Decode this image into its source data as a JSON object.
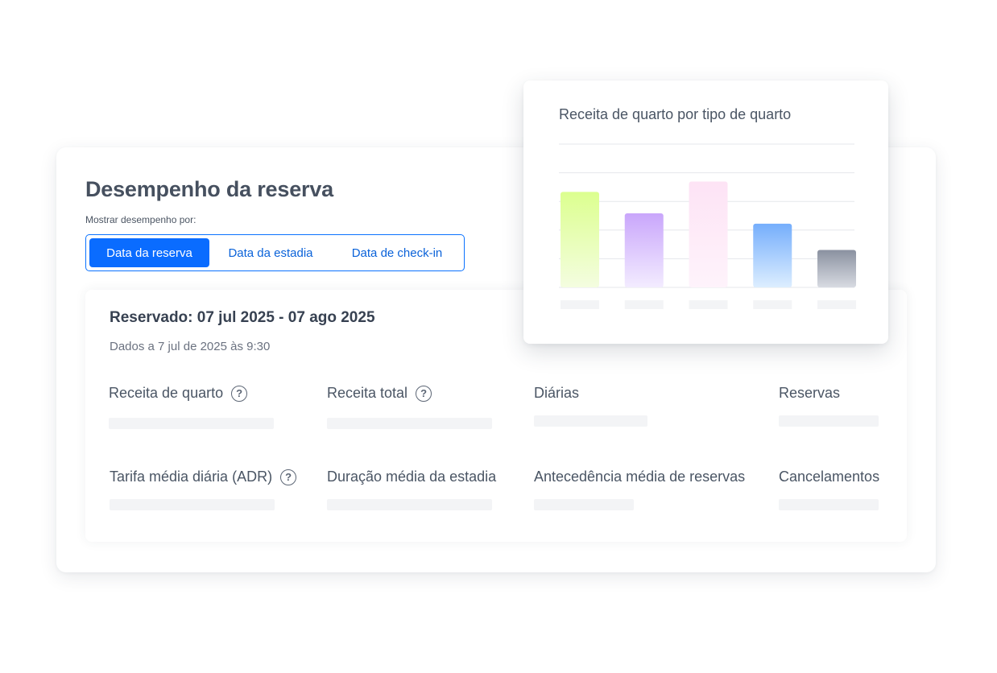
{
  "header": {
    "title": "Desempenho da reserva",
    "show_by_label": "Mostrar desempenho por:"
  },
  "tabs": [
    {
      "label": "Data da reserva",
      "active": true
    },
    {
      "label": "Data da estadia",
      "active": false
    },
    {
      "label": "Data de check-in",
      "active": false
    }
  ],
  "summary": {
    "period": "Reservado: 07 jul 2025 - 07 ago 2025",
    "data_as_of": "Dados a 7 jul de 2025 às 9:30"
  },
  "metrics": [
    {
      "label": "Receita de quarto",
      "help_icon": "question-circle-icon"
    },
    {
      "label": "Receita total",
      "help_icon": "question-circle-icon"
    },
    {
      "label": "Diárias"
    },
    {
      "label": "Reservas"
    },
    {
      "label": "Tarifa média diária (ADR)",
      "help_icon": "question-circle-icon"
    },
    {
      "label": "Duração média da estadia"
    },
    {
      "label": "Antecedência média de reservas"
    },
    {
      "label": "Cancelamentos"
    }
  ],
  "help_glyph": "?",
  "colors": {
    "accent": "#0a6cff",
    "bar_gradients": [
      [
        "#dcff8f",
        "#f4fde0"
      ],
      [
        "#c9a6fb",
        "#f3ecff"
      ],
      [
        "#fde3f5",
        "#fef3fb"
      ],
      [
        "#75aefc",
        "#ddeeff"
      ],
      [
        "#8a91a0",
        "#d8dbe2"
      ]
    ]
  },
  "chart_data": {
    "type": "bar",
    "title": "Receita de quarto por tipo de quarto",
    "categories": [
      "",
      "",
      "",
      "",
      ""
    ],
    "values": [
      120,
      93,
      133,
      80,
      47
    ],
    "ylim": [
      0,
      180
    ],
    "grid": true,
    "xlabel": "",
    "ylabel": ""
  }
}
